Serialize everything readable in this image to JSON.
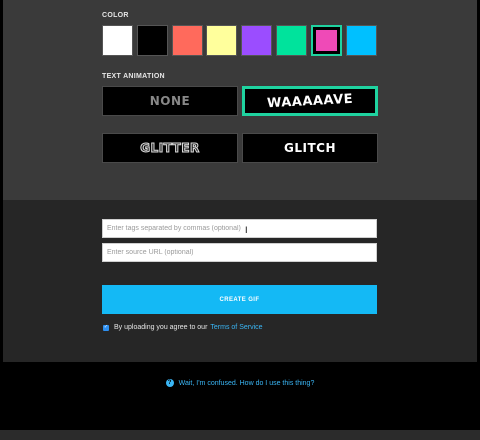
{
  "color_section": {
    "label": "COLOR",
    "swatches": [
      {
        "name": "white",
        "color": "#ffffff"
      },
      {
        "name": "black",
        "color": "#000000"
      },
      {
        "name": "salmon",
        "color": "#ff6a5c"
      },
      {
        "name": "yellow",
        "color": "#ffff9c"
      },
      {
        "name": "purple",
        "color": "#9b4dff"
      },
      {
        "name": "green",
        "color": "#00e39c"
      },
      {
        "name": "pink",
        "color": "#ef4ab7"
      },
      {
        "name": "blue",
        "color": "#00c0ff"
      }
    ],
    "selected": "pink"
  },
  "animation_section": {
    "label": "TEXT ANIMATION",
    "options": [
      {
        "id": "none",
        "label": "NONE"
      },
      {
        "id": "wave",
        "label": "WAAAAAVE"
      },
      {
        "id": "glitter",
        "label": "GLITTER"
      },
      {
        "id": "glitch",
        "label": "GLITCH"
      }
    ],
    "selected": "wave"
  },
  "form": {
    "tags_placeholder": "Enter tags separated by commas (optional)",
    "source_placeholder": "Enter source URL (optional)",
    "tags_value": "",
    "source_value": ""
  },
  "create_button": {
    "label": "CREATE GIF"
  },
  "terms": {
    "text": "By uploading you agree to our",
    "link": "Terms of Service",
    "checked": true
  },
  "help": {
    "icon": "question-icon",
    "text": "Wait, I'm confused. How do I use this thing?"
  },
  "colors": {
    "accent_selected": "#1fd3a0",
    "button_blue": "#14b9f5",
    "link_blue": "#3ab6f5"
  }
}
